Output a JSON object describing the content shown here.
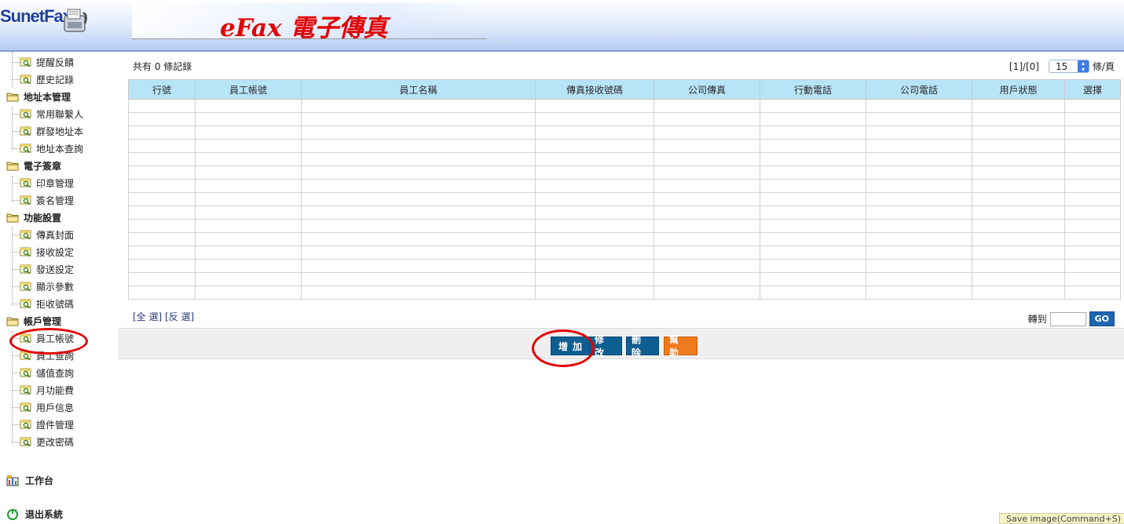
{
  "header": {
    "logo_text": "SunetFax",
    "banner_title": "eFax 電子傳真"
  },
  "sidebar": {
    "items": [
      {
        "label": "提醒反饋",
        "type": "leaf"
      },
      {
        "label": "歷史記錄",
        "type": "leaf"
      },
      {
        "label": "地址本管理",
        "type": "folder"
      },
      {
        "label": "常用聯繫人",
        "type": "leaf"
      },
      {
        "label": "群發地址本",
        "type": "leaf"
      },
      {
        "label": "地址本查詢",
        "type": "leaf"
      },
      {
        "label": "電子簽章",
        "type": "folder"
      },
      {
        "label": "印章管理",
        "type": "leaf"
      },
      {
        "label": "簽名管理",
        "type": "leaf"
      },
      {
        "label": "功能設置",
        "type": "folder"
      },
      {
        "label": "傳真封面",
        "type": "leaf"
      },
      {
        "label": "接收設定",
        "type": "leaf"
      },
      {
        "label": "發送設定",
        "type": "leaf"
      },
      {
        "label": "顯示參數",
        "type": "leaf"
      },
      {
        "label": "拒收號碼",
        "type": "leaf"
      },
      {
        "label": "帳戶管理",
        "type": "folder"
      },
      {
        "label": "員工帳號",
        "type": "leaf",
        "highlighted": true
      },
      {
        "label": "員工查詢",
        "type": "leaf"
      },
      {
        "label": "儲值查詢",
        "type": "leaf"
      },
      {
        "label": "月功能費",
        "type": "leaf"
      },
      {
        "label": "用戶信息",
        "type": "leaf"
      },
      {
        "label": "證件管理",
        "type": "leaf"
      },
      {
        "label": "更改密碼",
        "type": "leaf"
      }
    ],
    "workbench_label": "工作台",
    "logout_label": "退出系統"
  },
  "main": {
    "records_text": "共有 0 條記錄",
    "pager": {
      "page_text": "[1]/[0]",
      "per_page_value": "15",
      "per_page_unit": "條/頁"
    },
    "table": {
      "columns": [
        "行號",
        "員工帳號",
        "員工名稱",
        "傳真接收號碼",
        "公司傳真",
        "行動電話",
        "公司電話",
        "用戶狀態",
        "選擇"
      ],
      "empty_rows": 15
    },
    "select_all_label": "[全 選]",
    "invert_label": "[反 選]",
    "goto_label": "轉到",
    "goto_value": "",
    "go_button": "GO",
    "buttons": {
      "add": "增加",
      "edit": "修改",
      "delete": "刪除",
      "help": "幫助"
    }
  },
  "tooltip": "Save image(Command+S)",
  "colors": {
    "header_accent": "#7d9ad6",
    "table_header_bg": "#b8e4f8",
    "button_blue": "#0e5e92",
    "button_orange": "#f07a1e",
    "highlight_ring": "#e30000"
  }
}
